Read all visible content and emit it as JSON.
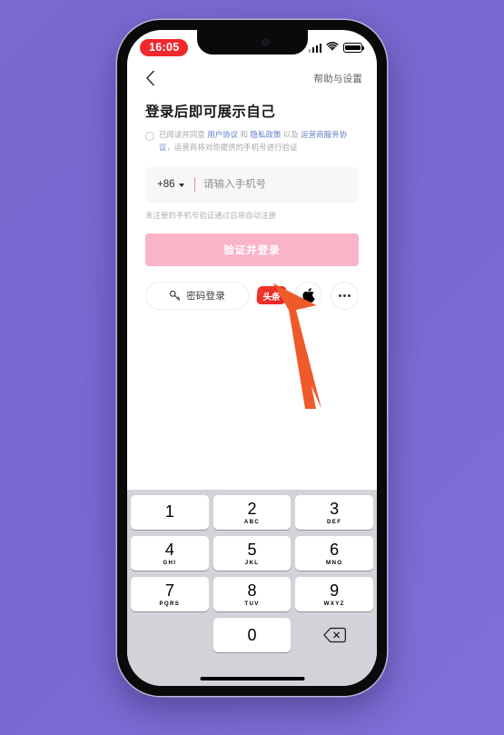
{
  "background": {
    "color": "#7767cf"
  },
  "device": {
    "frame_color": "#0a0a0a",
    "notch": "camera-notch"
  },
  "status_bar": {
    "time": "16:05",
    "time_pill_color": "#f0282d",
    "icons": [
      "signal-icon",
      "wifi-icon",
      "battery-icon"
    ]
  },
  "nav_bar": {
    "back_icon": "chevron-left-icon",
    "help_settings_label": "帮助与设置"
  },
  "login": {
    "title": "登录后即可展示自己",
    "agreement": {
      "checked": false,
      "prefix": "已阅读并同意 ",
      "link_user_agreement": "用户协议",
      "conjunction_1": " 和 ",
      "link_privacy_policy": "隐私政策",
      "conjunction_2": " 以及 ",
      "link_carrier_agreement": "运营商服务协议",
      "suffix": "，运营商将对你提供的手机号进行验证"
    },
    "phone_field": {
      "country_code": "+86",
      "caret_color": "#f08ca8",
      "value": "",
      "placeholder": "请输入手机号"
    },
    "register_hint": "未注册的手机号验证通过后将自动注册",
    "primary_button": {
      "label": "验证并登录",
      "color": "#f9b4c8"
    },
    "password_login": {
      "label": "密码登录",
      "icon": "key-icon"
    },
    "third_party": [
      {
        "name": "toutiao",
        "label": "头条",
        "color": "#e8242b"
      },
      {
        "name": "apple",
        "label": "apple-icon"
      },
      {
        "name": "more",
        "label": "more-dots-icon"
      }
    ]
  },
  "keyboard": {
    "type": "numeric-keypad",
    "rows": [
      [
        {
          "num": "1",
          "letters": ""
        },
        {
          "num": "2",
          "letters": "ABC"
        },
        {
          "num": "3",
          "letters": "DEF"
        }
      ],
      [
        {
          "num": "4",
          "letters": "GHI"
        },
        {
          "num": "5",
          "letters": "JKL"
        },
        {
          "num": "6",
          "letters": "MNO"
        }
      ],
      [
        {
          "num": "7",
          "letters": "PQRS"
        },
        {
          "num": "8",
          "letters": "TUV"
        },
        {
          "num": "9",
          "letters": "WXYZ"
        }
      ]
    ],
    "zero_key": {
      "num": "0",
      "letters": ""
    },
    "backspace_icon": "backspace-icon"
  },
  "annotation": {
    "arrow_color": "#ef5a2a",
    "points_at": "toutiao-login-button"
  }
}
